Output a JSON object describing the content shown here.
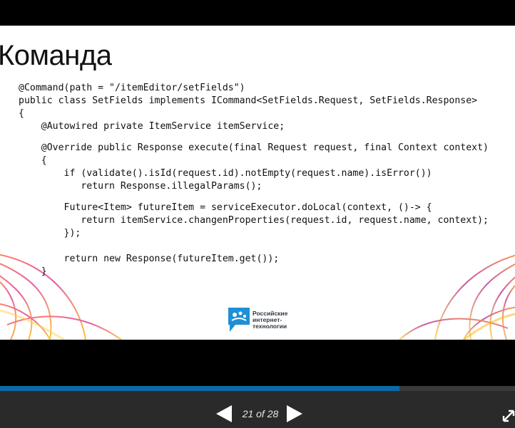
{
  "slide": {
    "title": "Команда",
    "code_lines": [
      "@Command(path = \"/itemEditor/setFields\")",
      "public class SetFields implements ICommand<SetFields.Request, SetFields.Response>",
      "{",
      "    @Autowired private ItemService itemService;",
      "    @Override public Response execute(final Request request, final Context context)",
      "    {",
      "        if (validate().isId(request.id).notEmpty(request.name).isError())",
      "           return Response.illegalParams();",
      "        Future<Item> futureItem = serviceExecutor.doLocal(context, ()-> {",
      "           return itemService.changenProperties(request.id, request.name, context);",
      "        });",
      "        return new Response(futureItem.get());",
      "    }"
    ],
    "logo": {
      "line1": "Российские",
      "line2": "интернет-",
      "line3": "технологии",
      "icon": "rit-logo-icon",
      "color": "#1f8fd6"
    }
  },
  "player": {
    "progress_fraction": 0.775,
    "progress_color": "#0b6aa6",
    "counter": "21 of 28",
    "prev_icon": "triangle-left-icon",
    "next_icon": "triangle-right-icon",
    "fullscreen_icon": "expand-icon"
  }
}
